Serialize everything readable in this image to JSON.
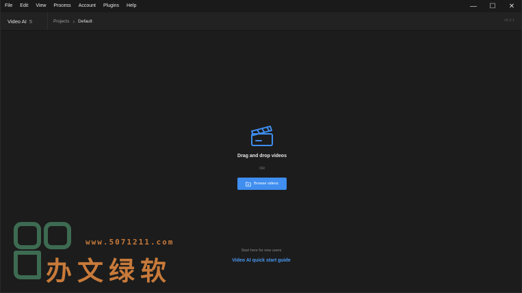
{
  "menu": [
    "File",
    "Edit",
    "View",
    "Process",
    "Account",
    "Plugins",
    "Help"
  ],
  "window_controls": {
    "minimize": "—",
    "maximize": "☐",
    "close": "✕"
  },
  "header": {
    "app_name": "Video AI",
    "app_major": "5",
    "breadcrumb_root": "Projects",
    "breadcrumb_current": "Default",
    "version": "v5.3.1"
  },
  "drop_zone": {
    "icon": "clapperboard-icon",
    "title": "Drag and drop videos",
    "or_label": "OR",
    "browse_label": "Browse videos"
  },
  "quickstart": {
    "caption": "Start here for new users",
    "link": "Video AI quick start guide"
  },
  "watermark": {
    "url": "www.5071211.com",
    "text": "办文绿软"
  },
  "colors": {
    "accent": "#3f8ef0",
    "link": "#4a98f0",
    "background": "#1c1c1c",
    "watermark": "#c87a3a",
    "watermark_logo": "#3d6b52"
  }
}
